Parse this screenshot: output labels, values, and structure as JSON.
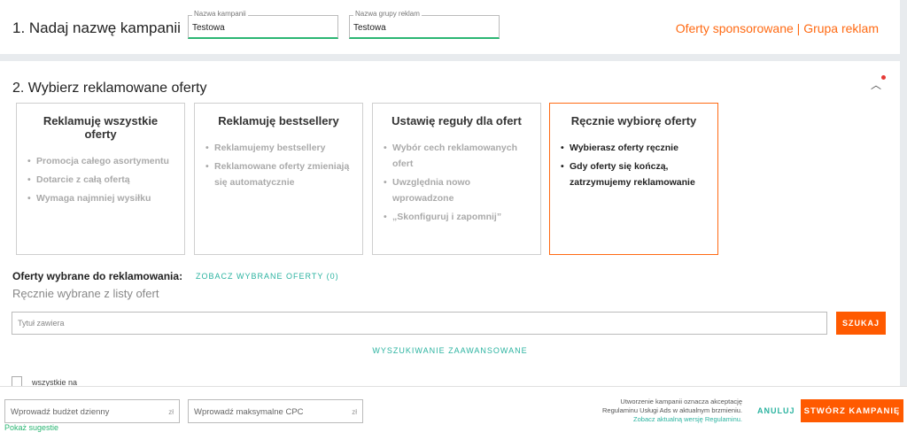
{
  "section1": {
    "title": "1. Nadaj nazwę kampanii",
    "campaign_label": "Nazwa kampanii",
    "campaign_value": "Testowa",
    "group_label": "Nazwa grupy reklam",
    "group_value": "Testowa",
    "breadcrumb": "Oferty sponsorowane | Grupa reklam"
  },
  "section2": {
    "title": "2. Wybierz reklamowane oferty",
    "collapse_icon": "chevron-up-icon",
    "cards": [
      {
        "title": "Reklamuję wszystkie oferty",
        "items": [
          "Promocja całego asortymentu",
          "Dotarcie z całą ofertą",
          "Wymaga najmniej wysiłku"
        ]
      },
      {
        "title": "Reklamuję bestsellery",
        "items": [
          "Reklamujemy bestsellery",
          "Reklamowane oferty zmieniają się automatycznie"
        ]
      },
      {
        "title": "Ustawię reguły dla ofert",
        "items": [
          "Wybór cech reklamowanych ofert",
          "Uwzględnia nowo wprowadzone",
          "„Skonfiguruj i zapomnij”"
        ]
      },
      {
        "title": "Ręcznie wybiorę oferty",
        "items": [
          "Wybierasz oferty ręcznie",
          "Gdy oferty się kończą, zatrzymujemy reklamowanie"
        ]
      }
    ],
    "selected_card": 3,
    "chosen_label": "Oferty wybrane do reklamowania:",
    "chosen_link": "ZOBACZ WYBRANE OFERTY (0)",
    "manual_label": "Ręcznie wybrane z listy ofert",
    "search_placeholder": "Tytuł zawiera",
    "search_button": "SZUKAJ",
    "advanced_search": "WYSZUKIWANIE ZAAWANSOWANE",
    "select_all_label": "wszystkie na"
  },
  "footer": {
    "budget_placeholder": "Wprowadź budżet dzienny",
    "cpc_placeholder": "Wprowadź maksymalne CPC",
    "currency": "zł",
    "suggest_link": "Pokaż sugestie",
    "terms_text": "Utworzenie kampanii oznacza akceptację Regulaminu Usługi Ads w aktualnym brzmieniu.",
    "terms_link": "Zobacz aktualną wersję Regulaminu.",
    "cancel_label": "ANULUJ",
    "create_label": "STWÓRZ KAMPANIĘ"
  },
  "colors": {
    "accent": "#ff5a00",
    "link": "#2bb3a0",
    "success": "#2bb673"
  }
}
